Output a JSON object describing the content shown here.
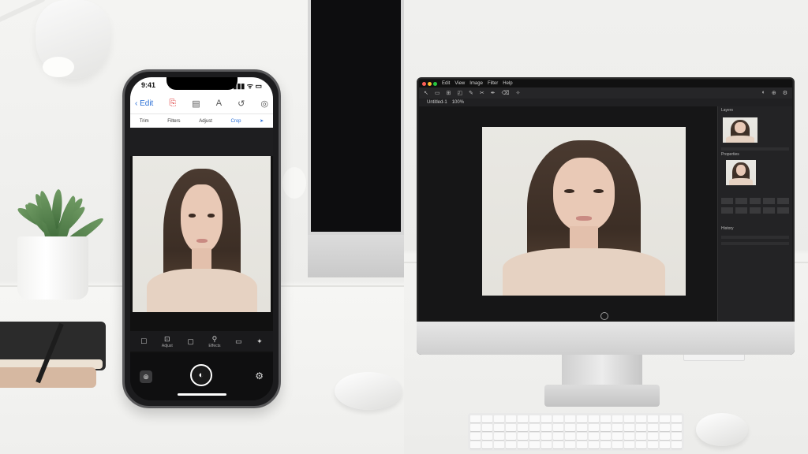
{
  "phone": {
    "status": {
      "time": "9:41",
      "signal": "▮▮▮ ᯤ ▭"
    },
    "toolbar": {
      "back_label": "‹ Edit",
      "icons": [
        "red-pdf-icon",
        "document-icon",
        "font-icon",
        "undo-icon",
        "more-icon"
      ]
    },
    "tabs": [
      "Trim",
      "Filters",
      "Adjust",
      "Crop"
    ],
    "edit_tools": [
      {
        "icon": "☐",
        "label": ""
      },
      {
        "icon": "⊡",
        "label": "Adjust"
      },
      {
        "icon": "▢",
        "label": ""
      },
      {
        "icon": "⚲",
        "label": "Effects"
      },
      {
        "icon": "▭",
        "label": ""
      },
      {
        "icon": "✦",
        "label": ""
      }
    ],
    "shutter_glyph": "◐",
    "left_btn": "⊕",
    "right_btn": "⚙"
  },
  "desktop_app": {
    "menu": [
      "Edit",
      "View",
      "Image",
      "Filter",
      "Help"
    ],
    "tab_title": "Untitled-1",
    "tab_sub": "100%",
    "toolbar_left": [
      "↖",
      "▭",
      "⊞",
      "◰",
      "✎",
      "✂",
      "✒",
      "⌫",
      "✧"
    ],
    "toolbar_right": [
      "◐",
      "⊕",
      "⚙"
    ],
    "rail_labels": [
      "Layers",
      "Properties",
      "History"
    ]
  },
  "colors": {
    "accent_blue": "#2a6fd6",
    "red": "#dd3333",
    "app_dark": "#1b1b1d"
  }
}
